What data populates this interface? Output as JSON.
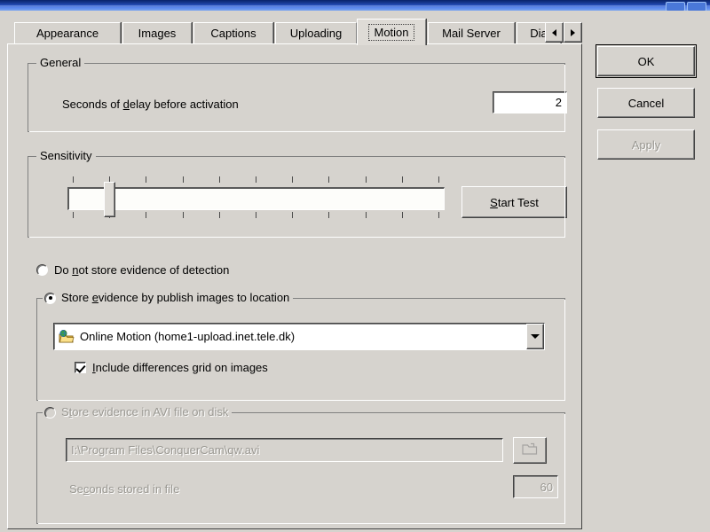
{
  "window": {
    "titlebar_buttons": [
      "minimize",
      "maximize",
      "close"
    ]
  },
  "tabs": {
    "items": [
      {
        "label": "Appearance",
        "selected": false
      },
      {
        "label": "Images",
        "selected": false
      },
      {
        "label": "Captions",
        "selected": false
      },
      {
        "label": "Uploading",
        "selected": false
      },
      {
        "label": "Motion",
        "selected": true
      },
      {
        "label": "Mail Server",
        "selected": false
      },
      {
        "label": "Dia",
        "selected": false
      }
    ],
    "scroll_prev_icon": "triangle-left-icon",
    "scroll_next_icon": "triangle-right-icon"
  },
  "general": {
    "title": "General",
    "delay_label_pre": "Seconds of ",
    "delay_label_accel": "d",
    "delay_label_post": "elay before activation",
    "delay_value": "2"
  },
  "sensitivity": {
    "title": "Sensitivity",
    "slider_min": 0,
    "slider_max": 10,
    "slider_value": 1,
    "tick_count": 11,
    "start_test_pre": "",
    "start_test_accel": "S",
    "start_test_post": "tart Test",
    "start_test_label": "Start Test"
  },
  "storage": {
    "option_none": {
      "pre": "Do ",
      "accel": "n",
      "post": "ot store evidence of detection",
      "label": "Do not store evidence of detection",
      "selected": false
    },
    "option_publish": {
      "pre": "Store ",
      "accel": "e",
      "post": "vidence by publish images to location",
      "label": "Store evidence by publish images to location",
      "selected": true,
      "location_icon": "web-folder-icon",
      "location_value": "Online Motion (home1-upload.inet.tele.dk)",
      "dropdown_icon": "chevron-down-icon",
      "include_grid": {
        "pre": "",
        "accel": "I",
        "post": "nclude differences grid on images",
        "label": "Include differences grid on images",
        "checked": true
      }
    },
    "option_avi": {
      "pre": "S",
      "accel": "t",
      "post": "ore evidence in AVI file on disk",
      "label": "Store evidence in AVI file on disk",
      "selected": false,
      "enabled": false,
      "path_value": "I:\\Program Files\\ConquerCam\\qw.avi",
      "browse_icon": "folder-browse-icon",
      "seconds_label_pre": "Se",
      "seconds_label_accel": "c",
      "seconds_label_post": "onds stored in file",
      "seconds_label": "Seconds stored in file",
      "seconds_value": "60"
    }
  },
  "actions": {
    "ok_label": "OK",
    "cancel_label": "Cancel",
    "apply_label": "Apply",
    "apply_enabled": false
  },
  "colors": {
    "face": "#d6d3ce",
    "titlebar_start": "#0a246a",
    "titlebar_end": "#7aa5f0",
    "disabled_text": "#9a9892",
    "field_bg": "#ffffff"
  }
}
